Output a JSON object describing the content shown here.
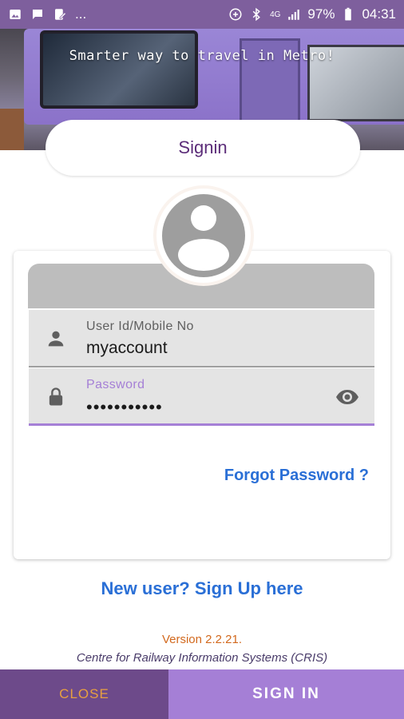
{
  "status_bar": {
    "left_icons": [
      "image-icon",
      "chat-icon",
      "edit-icon"
    ],
    "overflow": "...",
    "right_icons": [
      "sync-icon",
      "bluetooth-icon",
      "signal-icon",
      "battery-icon"
    ],
    "network": "4G",
    "battery": "97%",
    "time": "04:31"
  },
  "hero": {
    "tagline": "Smarter way to travel in Metro!"
  },
  "header": {
    "title": "Signin"
  },
  "form": {
    "user_label": "User Id/Mobile No",
    "user_value": "myaccount",
    "password_label": "Password",
    "password_value": "•••••••••••",
    "forgot": "Forgot Password ?"
  },
  "signup": "New user? Sign Up here",
  "footer": {
    "version": "Version 2.2.21",
    "version_dot": ".",
    "org": "Centre for Railway Information Systems (CRIS)"
  },
  "bottom": {
    "close": "CLOSE",
    "signin": "SIGN IN"
  },
  "colors": {
    "statusbar": "#7e5f9d",
    "accent": "#a57fd6",
    "dark_accent": "#6d4a8a",
    "link": "#2a6fd6",
    "close_text": "#e8a040",
    "title": "#5c2d79"
  }
}
